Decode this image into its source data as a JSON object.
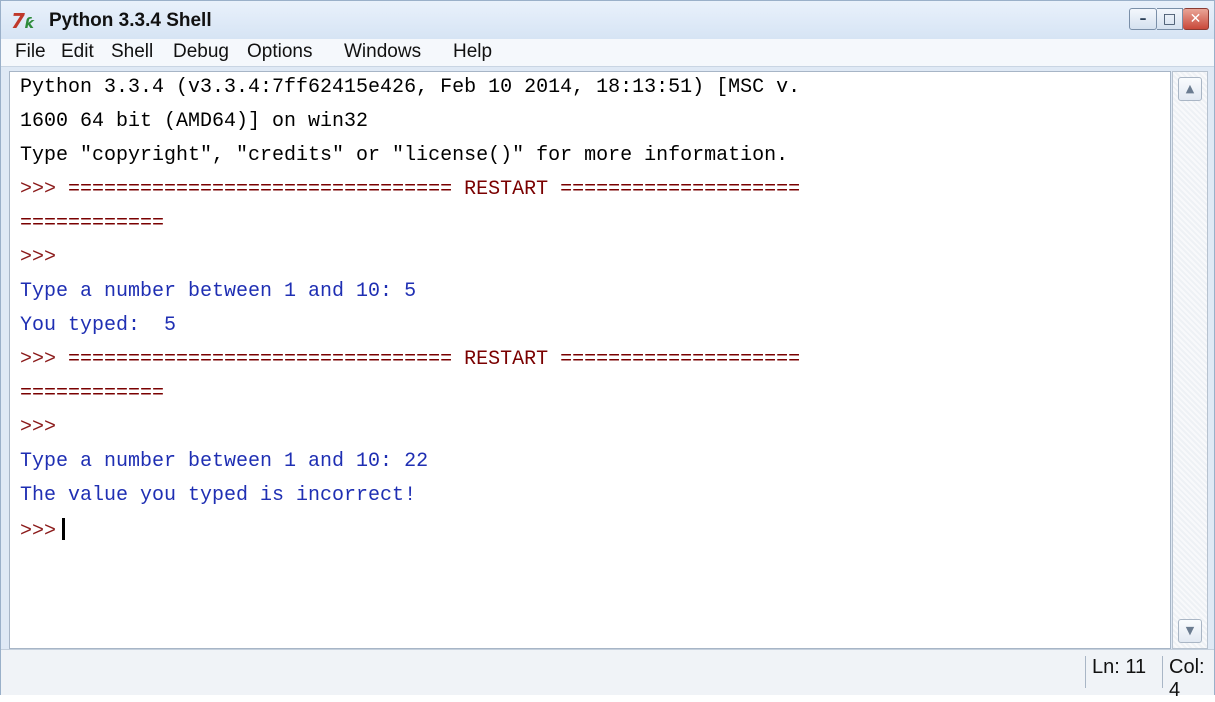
{
  "window": {
    "title": "Python 3.3.4 Shell",
    "icon": "tk-feather-icon"
  },
  "menu": [
    "File",
    "Edit",
    "Shell",
    "Debug",
    "Options",
    "Windows",
    "Help"
  ],
  "shell": {
    "banner1": "Python 3.3.4 (v3.3.4:7ff62415e426, Feb 10 2014, 18:13:51) [MSC v.",
    "banner2": "1600 64 bit (AMD64)] on win32",
    "banner3": "Type \"copyright\", \"credits\" or \"license()\" for more information.",
    "prompt": ">>>",
    "restart1": " ================================ RESTART ====================",
    "restart_cont": "============",
    "run1_input": "Type a number between 1 and 10: 5",
    "run1_output": "You typed:  5",
    "restart2": " ================================ RESTART ====================",
    "run2_input": "Type a number between 1 and 10: 22",
    "run2_output": "The value you typed is incorrect!"
  },
  "status": {
    "line": "Ln: 11",
    "col": "Col: 4"
  },
  "colors": {
    "prompt": "#8b1a1a",
    "output": "#1f2fb3",
    "text": "#000000"
  }
}
